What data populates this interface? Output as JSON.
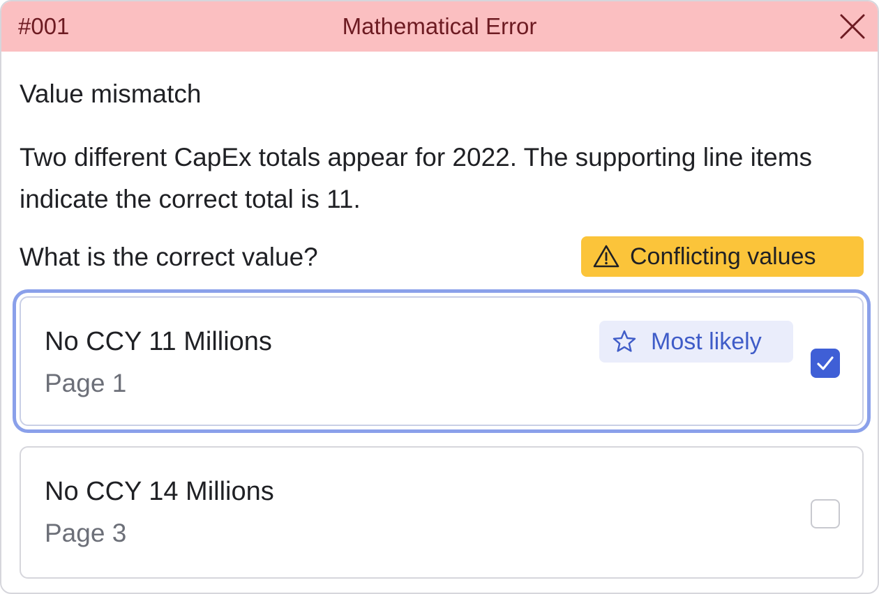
{
  "header": {
    "id": "#001",
    "title": "Mathematical Error",
    "close_icon": "close-icon",
    "background_color": "#fbbfc1",
    "text_color": "#6d1b22"
  },
  "body": {
    "heading": "Value mismatch",
    "description": "Two different CapEx totals appear for 2022. The supporting line items indicate the correct total is 11.",
    "question": "What is the correct value?",
    "warning_badge": {
      "icon": "warning-triangle-icon",
      "label": "Conflicting values",
      "color": "#fbc43a"
    }
  },
  "options": [
    {
      "title": "No CCY 11 Millions",
      "subtitle": "Page 1",
      "badge": {
        "icon": "star-outline-icon",
        "label": "Most likely",
        "color": "#3f5cc8"
      },
      "checked": true
    },
    {
      "title": "No CCY 14 Millions",
      "subtitle": "Page 3",
      "checked": false
    }
  ],
  "accent_color": "#3f5fd6"
}
